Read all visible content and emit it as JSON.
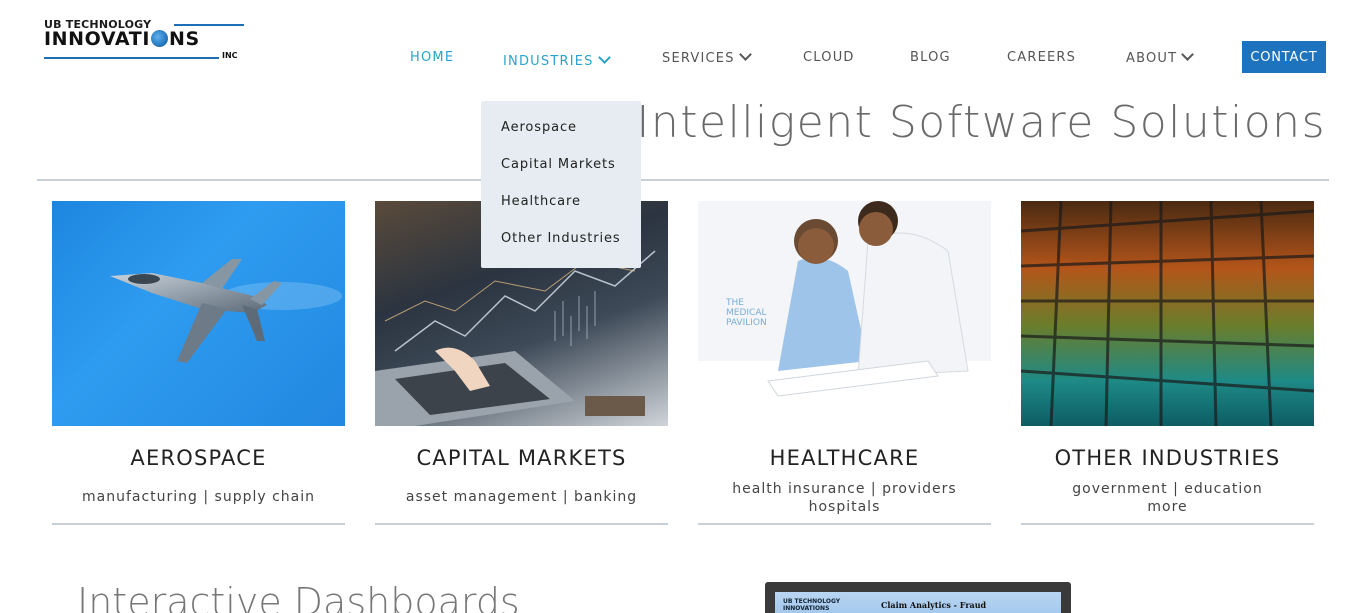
{
  "logo": {
    "top_text": "UB TECHNOLOGY",
    "main_before": "INNOVATI",
    "main_after": "NS",
    "suffix": "INC",
    "accent_color": "#1e6fb5"
  },
  "nav": {
    "items": [
      {
        "label": "HOME",
        "active": true
      },
      {
        "label": "INDUSTRIES",
        "active": true,
        "has_dropdown": true
      },
      {
        "label": "SERVICES",
        "has_dropdown": true
      },
      {
        "label": "CLOUD"
      },
      {
        "label": "BLOG"
      },
      {
        "label": "CAREERS"
      },
      {
        "label": "ABOUT",
        "has_dropdown": true
      }
    ],
    "contact_label": "CONTACT",
    "active_color": "#2aa3cc",
    "contact_color": "#1e73be"
  },
  "dropdown": {
    "items": [
      "Aerospace",
      "Capital Markets",
      "Healthcare",
      "Other Industries"
    ]
  },
  "hero": {
    "title": "Intelligent Software Solutions"
  },
  "cards": [
    {
      "title": "AEROSPACE",
      "sub1": "manufacturing | supply chain",
      "sub2": ""
    },
    {
      "title": "CAPITAL MARKETS",
      "sub1": "asset management | banking",
      "sub2": ""
    },
    {
      "title": "HEALTHCARE",
      "sub1": "health insurance | providers",
      "sub2": "hospitals"
    },
    {
      "title": "OTHER INDUSTRIES",
      "sub1": "government | education",
      "sub2": "more"
    }
  ],
  "healthcare_sign": {
    "line1": "THE",
    "line2": "MEDICAL",
    "line3": "PAVILION"
  },
  "dashboard": {
    "title": "Interactive Dashboards",
    "screen_logo_line1": "UB TECHNOLOGY",
    "screen_logo_line2": "INNOVATIONS",
    "screen_title": "Claim Analytics - Fraud"
  }
}
